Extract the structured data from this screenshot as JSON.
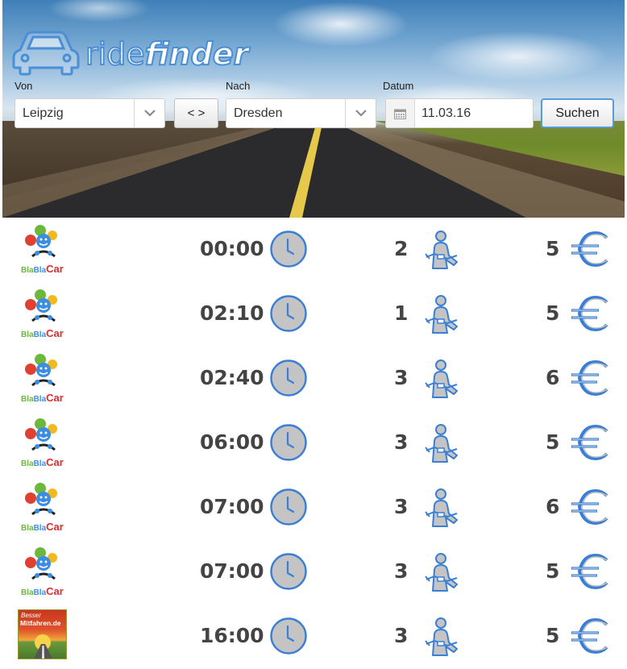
{
  "app": {
    "brand_part1": "ride",
    "brand_part2": "finder"
  },
  "search": {
    "from_label": "Von",
    "from_value": "Leipzig",
    "swap_label": "< >",
    "to_label": "Nach",
    "to_value": "Dresden",
    "date_label": "Datum",
    "date_value": "11.03.16",
    "submit_label": "Suchen"
  },
  "colors": {
    "accent": "#4a8fd6",
    "icon_fill": "#c0c0c0",
    "icon_stroke": "#3a7fd5",
    "text": "#444444"
  },
  "results": [
    {
      "provider": "BlaBlaCar",
      "provider_logo_text": [
        "Bla",
        "Bla",
        "Car"
      ],
      "time": "00:00",
      "seats": "2",
      "price": "5"
    },
    {
      "provider": "BlaBlaCar",
      "provider_logo_text": [
        "Bla",
        "Bla",
        "Car"
      ],
      "time": "02:10",
      "seats": "1",
      "price": "5"
    },
    {
      "provider": "BlaBlaCar",
      "provider_logo_text": [
        "Bla",
        "Bla",
        "Car"
      ],
      "time": "02:40",
      "seats": "3",
      "price": "6"
    },
    {
      "provider": "BlaBlaCar",
      "provider_logo_text": [
        "Bla",
        "Bla",
        "Car"
      ],
      "time": "06:00",
      "seats": "3",
      "price": "5"
    },
    {
      "provider": "BlaBlaCar",
      "provider_logo_text": [
        "Bla",
        "Bla",
        "Car"
      ],
      "time": "07:00",
      "seats": "3",
      "price": "6"
    },
    {
      "provider": "BlaBlaCar",
      "provider_logo_text": [
        "Bla",
        "Bla",
        "Car"
      ],
      "time": "07:00",
      "seats": "3",
      "price": "5"
    },
    {
      "provider": "BesserMitfahren.de",
      "provider_logo_text": [
        "Besser",
        "Mitfahren.de"
      ],
      "time": "16:00",
      "seats": "3",
      "price": "5"
    }
  ],
  "icons": {
    "logo": "car-icon",
    "caret": "chevron-down-icon",
    "calendar": "calendar-icon",
    "time": "clock-icon",
    "seats": "seatbelt-icon",
    "price": "euro-icon"
  }
}
